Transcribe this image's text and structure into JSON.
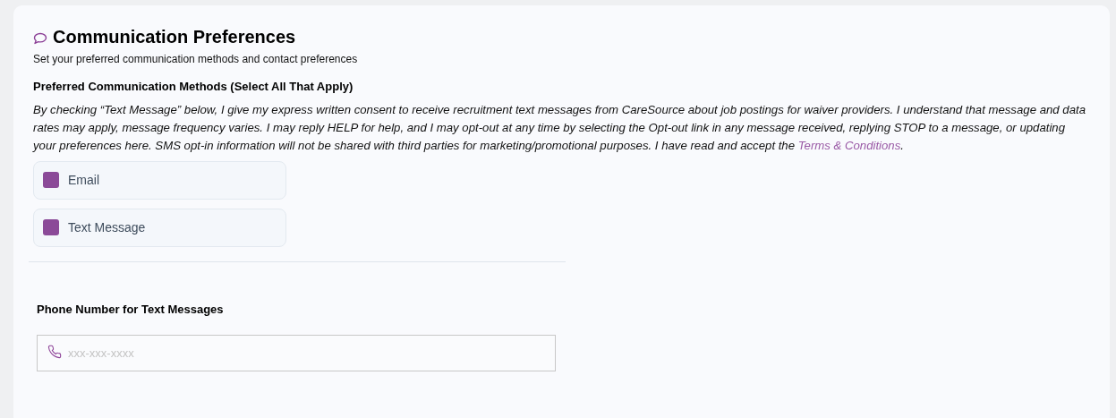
{
  "section": {
    "title": "Communication Preferences",
    "subtitle": "Set your preferred communication methods and contact preferences"
  },
  "methods": {
    "heading": "Preferred Communication Methods (Select All That Apply)",
    "consent": " By checking “Text Message” below, I give my express written consent to receive recruitment text messages from CareSource about job postings for waiver providers. I understand that message and data rates may apply, message frequency varies. I may reply HELP for help, and I may opt-out at any time by selecting the Opt-out link in any message received, replying STOP to a message, or updating your preferences here. SMS opt-in information will not be shared with third parties for marketing/promotional purposes. I have read and accept the ",
    "consent_link": "Terms & Conditions",
    "consent_end": ".",
    "options": [
      {
        "label": "Email",
        "checked": true
      },
      {
        "label": "Text Message",
        "checked": true
      }
    ]
  },
  "phone": {
    "label": "Phone Number for Text Messages",
    "placeholder": "xxx-xxx-xxxx"
  }
}
